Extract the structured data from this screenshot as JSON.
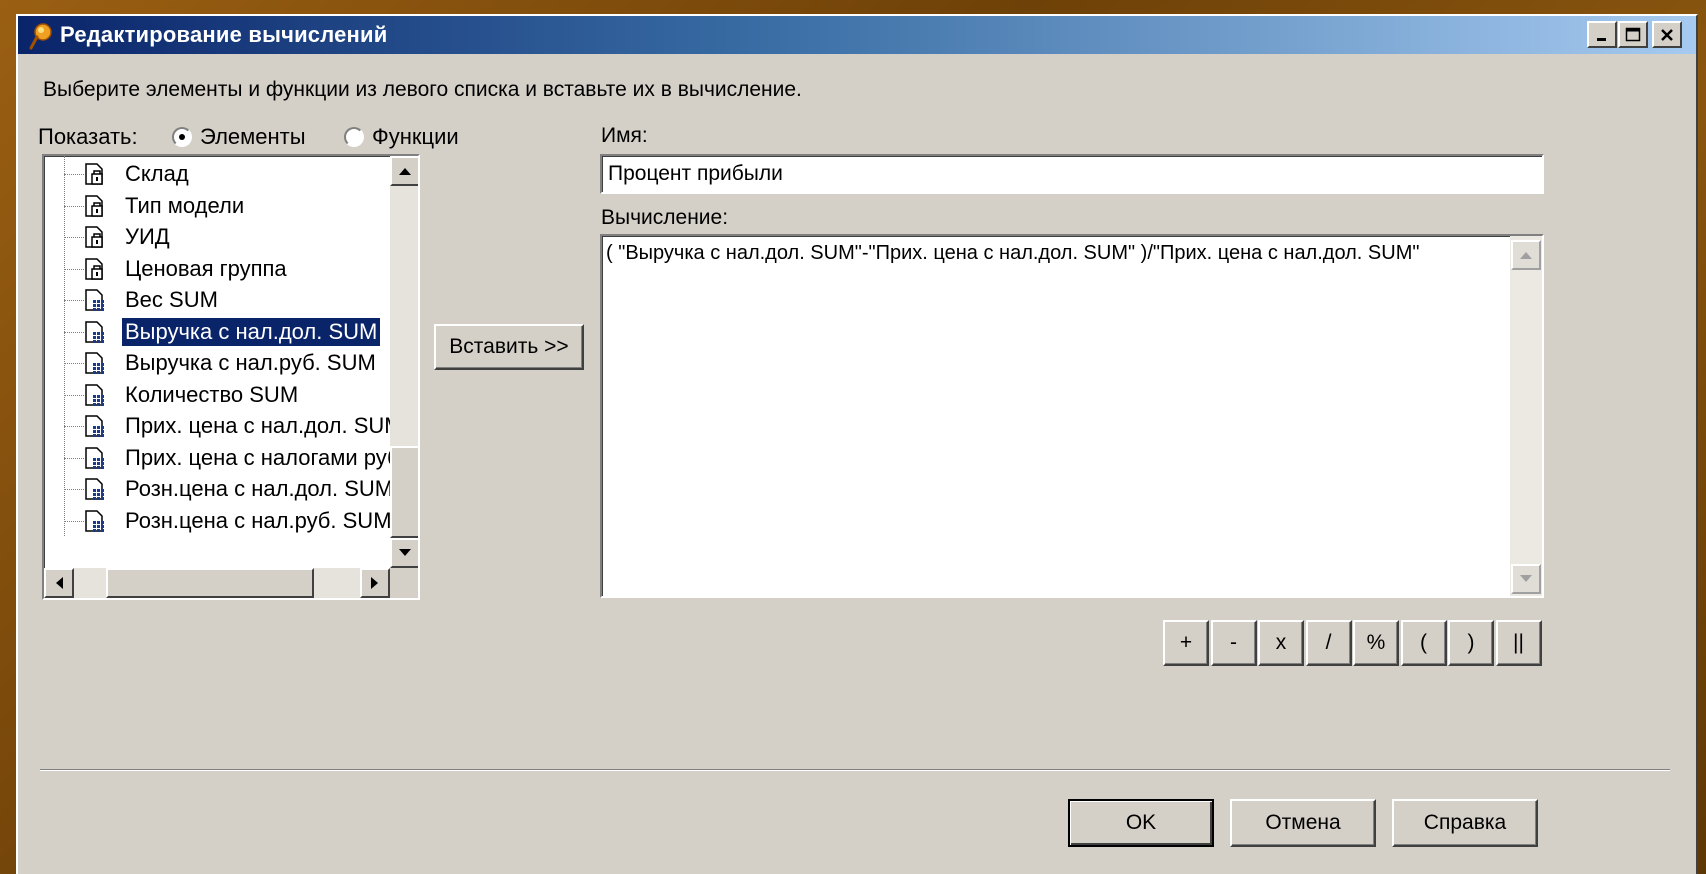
{
  "window": {
    "title": "Редактирование вычислений",
    "icon": "key-pin-icon",
    "controls": [
      "minimize-icon",
      "maximize-icon",
      "close-icon"
    ]
  },
  "instruction": "Выберите элементы и функции из левого списка и вставьте их в вычисление.",
  "show": {
    "label": "Показать:",
    "options": [
      {
        "label": "Элементы",
        "checked": true
      },
      {
        "label": "Функции",
        "checked": false
      }
    ]
  },
  "tree": {
    "items": [
      {
        "label": "Склад",
        "icon": "dimension-icon",
        "selected": false
      },
      {
        "label": "Тип модели",
        "icon": "dimension-icon",
        "selected": false
      },
      {
        "label": "УИД",
        "icon": "dimension-icon",
        "selected": false
      },
      {
        "label": "Ценовая группа",
        "icon": "dimension-icon",
        "selected": false
      },
      {
        "label": "Вес SUM",
        "icon": "measure-icon",
        "selected": false
      },
      {
        "label": "Выручка с нал.дол. SUM",
        "icon": "measure-icon",
        "selected": true
      },
      {
        "label": "Выручка с нал.руб. SUM",
        "icon": "measure-icon",
        "selected": false
      },
      {
        "label": "Количество SUM",
        "icon": "measure-icon",
        "selected": false
      },
      {
        "label": "Прих. цена с нал.дол. SUM",
        "icon": "measure-icon",
        "selected": false
      },
      {
        "label": "Прих. цена с налогами руб",
        "icon": "measure-icon",
        "selected": false
      },
      {
        "label": "Розн.цена с нал.дол. SUM",
        "icon": "measure-icon",
        "selected": false
      },
      {
        "label": "Розн.цена с нал.руб. SUM",
        "icon": "measure-icon",
        "selected": false
      }
    ]
  },
  "insert_button": "Вставить >>",
  "name": {
    "label": "Имя:",
    "value": "Процент прибыли"
  },
  "calculation": {
    "label": "Вычисление:",
    "value": "( \"Выручка с нал.дол. SUM\"-\"Прих. цена с нал.дол. SUM\" )/\"Прих. цена с нал.дол. SUM\""
  },
  "operators": [
    "+",
    "-",
    "x",
    "/",
    "%",
    "(",
    ")",
    "||"
  ],
  "buttons": {
    "ok": "OK",
    "cancel": "Отмена",
    "help": "Справка"
  },
  "colors": {
    "title_start": "#0a246a",
    "title_end": "#a6caf0",
    "dialog_face": "#d4d0c8",
    "selection": "#0a246a"
  }
}
